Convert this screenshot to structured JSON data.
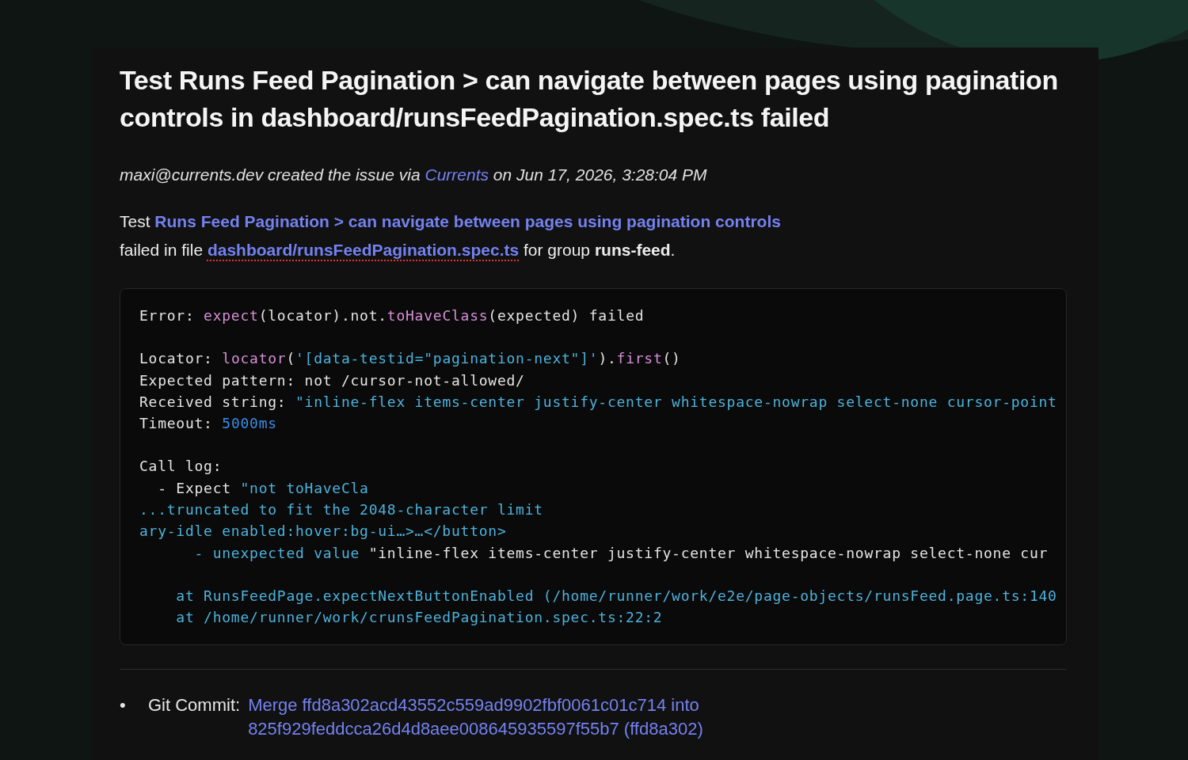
{
  "issue": {
    "title": "Test Runs Feed Pagination > can navigate between pages using pagination controls in dashboard/runsFeedPagination.spec.ts failed",
    "meta": {
      "author": "maxi@currents.dev",
      "middle": "created the issue via",
      "link": "Currents",
      "date": "on Jun 17, 2026, 3:28:04 PM"
    },
    "description": {
      "test_prefix": "Test",
      "test_link": "Runs Feed Pagination > can navigate between pages using pagination controls",
      "file_prefix": "failed in file",
      "file_link": "dashboard/runsFeedPagination.spec.ts",
      "suffix": "for group **runs-feed**."
    },
    "error_log": {
      "blocks": [
        {
          "lines": [
            {
              "parts": [
                {
                  "kind": "plain",
                  "text": "Error: "
                },
                {
                  "kind": "fn",
                  "text": "expect"
                },
                {
                  "kind": "plain",
                  "text": "(locator).not."
                },
                {
                  "kind": "fn",
                  "text": "toHaveClass"
                },
                {
                  "kind": "plain",
                  "text": "(expected) failed"
                }
              ]
            }
          ]
        },
        {
          "lines": [
            {
              "parts": [
                {
                  "kind": "plain",
                  "text": "Locator: "
                },
                {
                  "kind": "fn",
                  "text": "locator"
                },
                {
                  "kind": "plain",
                  "text": "("
                },
                {
                  "kind": "str",
                  "text": "'[data-testid=\"pagination-next\"]'"
                },
                {
                  "kind": "plain",
                  "text": ")."
                },
                {
                  "kind": "fn",
                  "text": "first"
                },
                {
                  "kind": "plain",
                  "text": "()"
                }
              ]
            },
            {
              "parts": [
                {
                  "kind": "plain",
                  "text": "Expected pattern: not /cursor-not-allowed/"
                }
              ]
            },
            {
              "parts": [
                {
                  "kind": "plain",
                  "text": "Received string: "
                },
                {
                  "kind": "str",
                  "text": "\"inline-flex items-center justify-center whitespace-nowrap select-none cursor-point"
                }
              ]
            },
            {
              "parts": [
                {
                  "kind": "plain",
                  "text": "Timeout: "
                },
                {
                  "kind": "num",
                  "text": "5000ms"
                }
              ]
            }
          ]
        },
        {
          "lines": [
            {
              "parts": [
                {
                  "kind": "plain",
                  "text": "Call log:"
                }
              ]
            },
            {
              "parts": [
                {
                  "kind": "plain",
                  "text": "  - Expect "
                },
                {
                  "kind": "str",
                  "text": "\"not toHaveCla"
                }
              ]
            },
            {
              "parts": [
                {
                  "kind": "str",
                  "text": "...truncated to fit the 2048-character limit"
                }
              ]
            },
            {
              "parts": [
                {
                  "kind": "str",
                  "text": "ary-idle enabled:hover:bg-ui…>…</button>"
                }
              ]
            },
            {
              "parts": [
                {
                  "kind": "str",
                  "text": "      - unexpected value "
                },
                {
                  "kind": "plain",
                  "text": "\"inline-flex items-center justify-center whitespace-nowrap select-none cur"
                }
              ]
            }
          ]
        },
        {
          "lines": [
            {
              "parts": [
                {
                  "kind": "str",
                  "text": "    at RunsFeedPage.expectNextButtonEnabled (/home/runner/work/e2e/page-objects/runsFeed.page.ts:140"
                }
              ]
            },
            {
              "parts": [
                {
                  "kind": "str",
                  "text": "    at /home/runner/work/crunsFeedPagination.spec.ts:22:2"
                }
              ]
            }
          ]
        }
      ]
    },
    "details": [
      {
        "bullet": "•",
        "label": "Git Commit:",
        "link": "Merge ffd8a302acd43552c559ad9902fbf0061c01c714 into 825f929feddcca26d4d8aee008645935597f55b7 (ffd8a302)"
      }
    ]
  }
}
